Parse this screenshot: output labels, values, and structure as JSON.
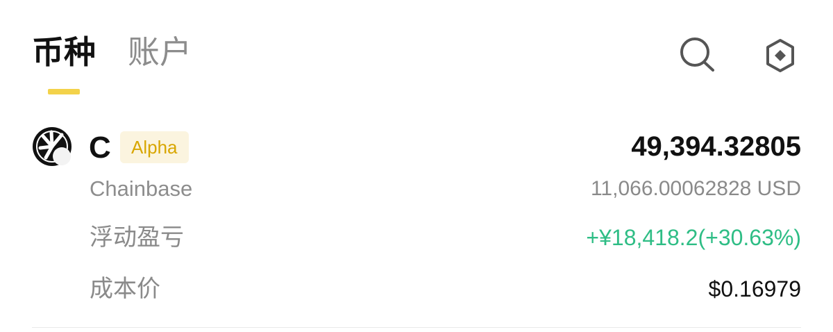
{
  "tabs": {
    "coin": "币种",
    "account": "账户"
  },
  "icons": {
    "search": "search-icon",
    "settings": "hexagon-settings-icon",
    "coin": "chainbase-coin-icon"
  },
  "asset": {
    "symbol": "C",
    "badge": "Alpha",
    "name": "Chainbase",
    "amount": "49,394.32805",
    "value_usd": "11,066.00062828 USD",
    "floating_pnl_label": "浮动盈亏",
    "floating_pnl_value": "+¥18,418.2(+30.63%)",
    "cost_price_label": "成本价",
    "cost_price_value": "$0.16979"
  },
  "colors": {
    "accent": "#f3d24a",
    "positive": "#2ebd85",
    "badge_bg": "#fbf4df",
    "badge_text": "#d8a600",
    "muted": "#8a8a8a"
  }
}
